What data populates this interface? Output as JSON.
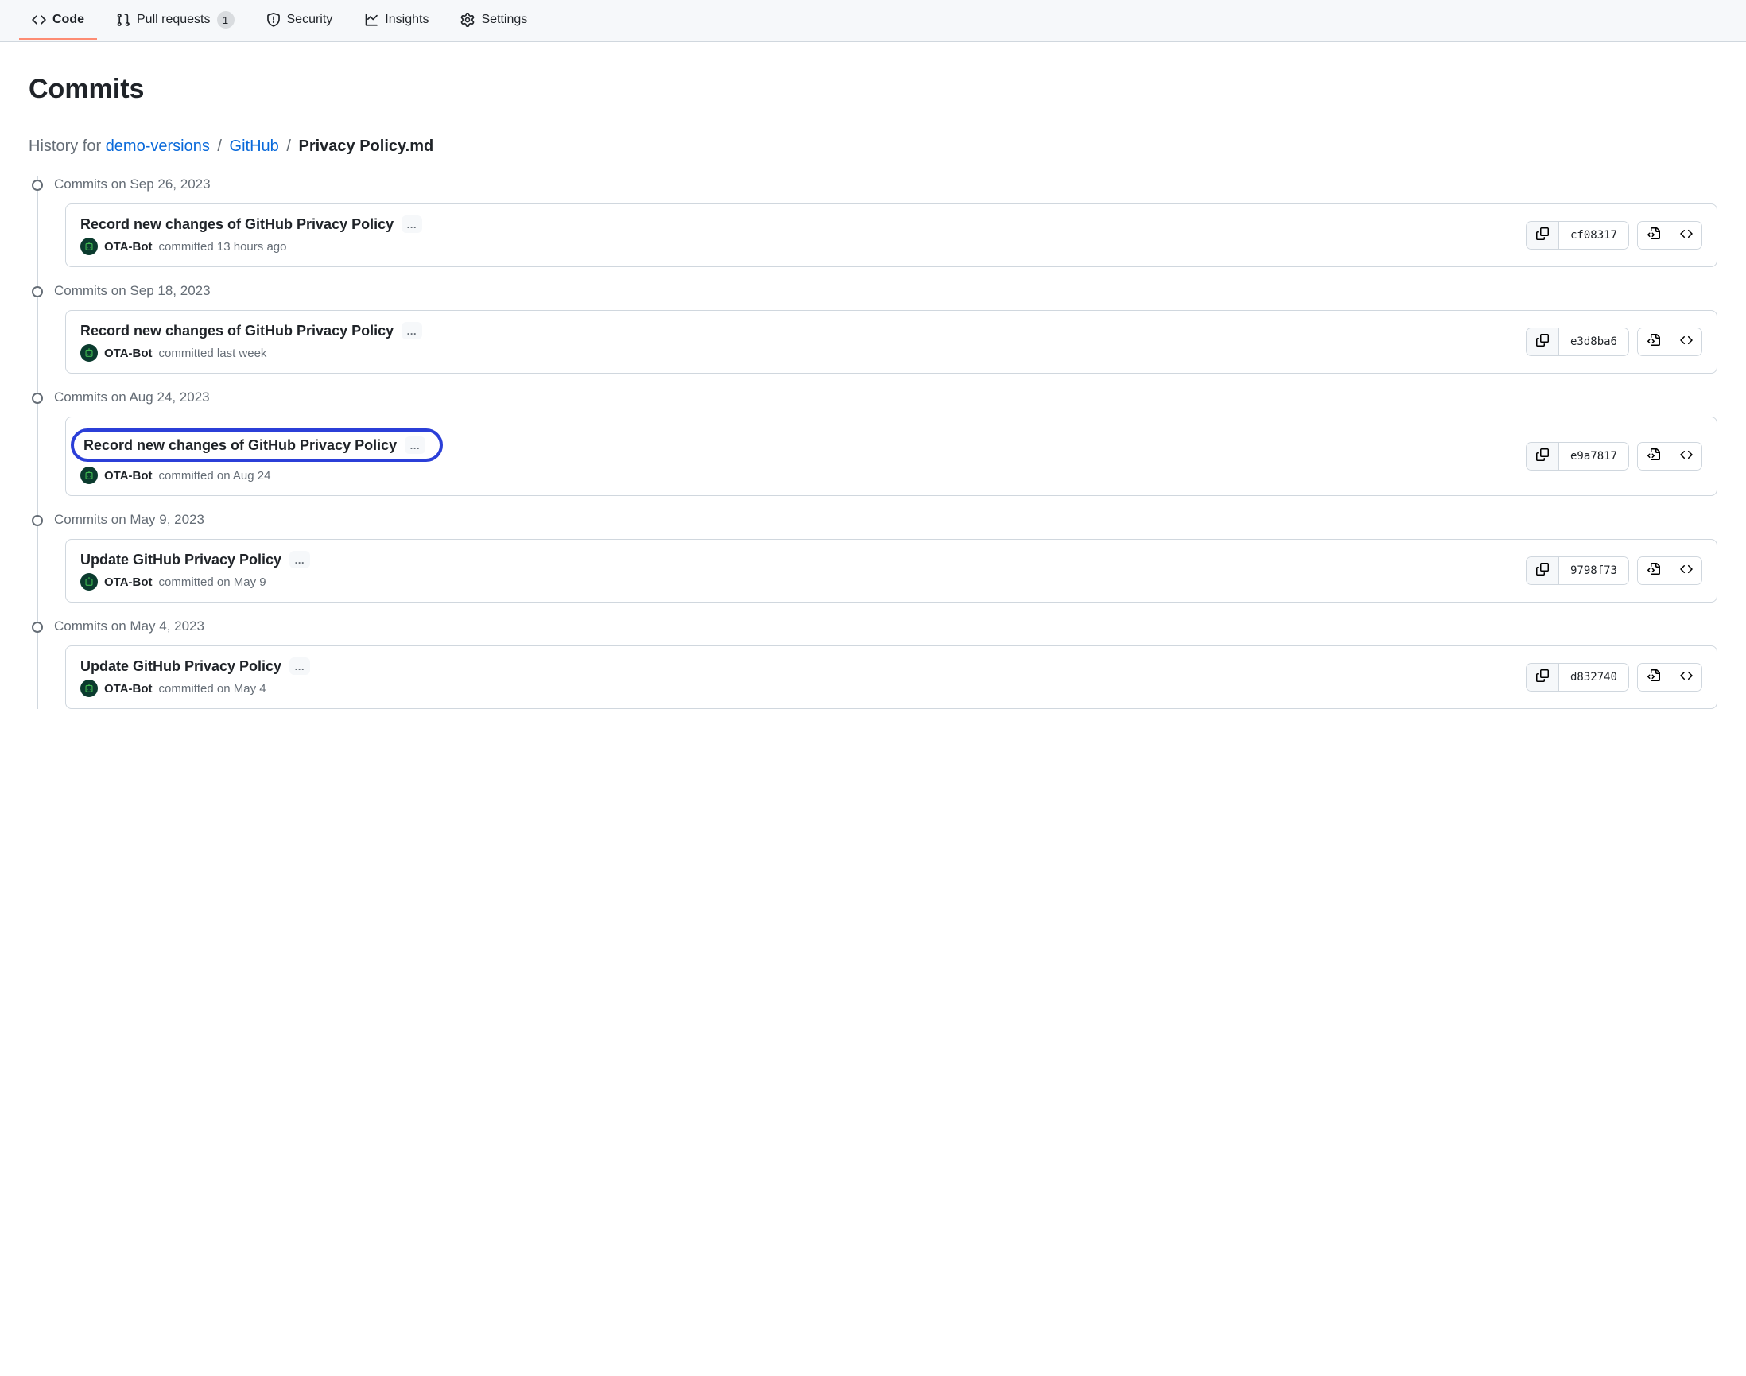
{
  "tabs": [
    {
      "label": "Code",
      "icon": "code-icon",
      "active": true
    },
    {
      "label": "Pull requests",
      "icon": "pull-request-icon",
      "active": false,
      "count": "1"
    },
    {
      "label": "Security",
      "icon": "shield-icon",
      "active": false
    },
    {
      "label": "Insights",
      "icon": "graph-icon",
      "active": false
    },
    {
      "label": "Settings",
      "icon": "gear-icon",
      "active": false
    }
  ],
  "page_title": "Commits",
  "breadcrumb": {
    "prefix": "History for",
    "parts": [
      {
        "text": "demo-versions",
        "link": true
      },
      {
        "text": "GitHub",
        "link": true
      },
      {
        "text": "Privacy Policy.md",
        "link": false
      }
    ]
  },
  "groups": [
    {
      "date": "Commits on Sep 26, 2023",
      "commits": [
        {
          "title": "Record new changes of GitHub Privacy Policy",
          "author": "OTA-Bot",
          "time": "committed 13 hours ago",
          "sha": "cf08317",
          "highlighted": false
        }
      ]
    },
    {
      "date": "Commits on Sep 18, 2023",
      "commits": [
        {
          "title": "Record new changes of GitHub Privacy Policy",
          "author": "OTA-Bot",
          "time": "committed last week",
          "sha": "e3d8ba6",
          "highlighted": false
        }
      ]
    },
    {
      "date": "Commits on Aug 24, 2023",
      "commits": [
        {
          "title": "Record new changes of GitHub Privacy Policy",
          "author": "OTA-Bot",
          "time": "committed on Aug 24",
          "sha": "e9a7817",
          "highlighted": true
        }
      ]
    },
    {
      "date": "Commits on May 9, 2023",
      "commits": [
        {
          "title": "Update GitHub Privacy Policy",
          "author": "OTA-Bot",
          "time": "committed on May 9",
          "sha": "9798f73",
          "highlighted": false
        }
      ]
    },
    {
      "date": "Commits on May 4, 2023",
      "commits": [
        {
          "title": "Update GitHub Privacy Policy",
          "author": "OTA-Bot",
          "time": "committed on May 4",
          "sha": "d832740",
          "highlighted": false
        }
      ]
    }
  ]
}
